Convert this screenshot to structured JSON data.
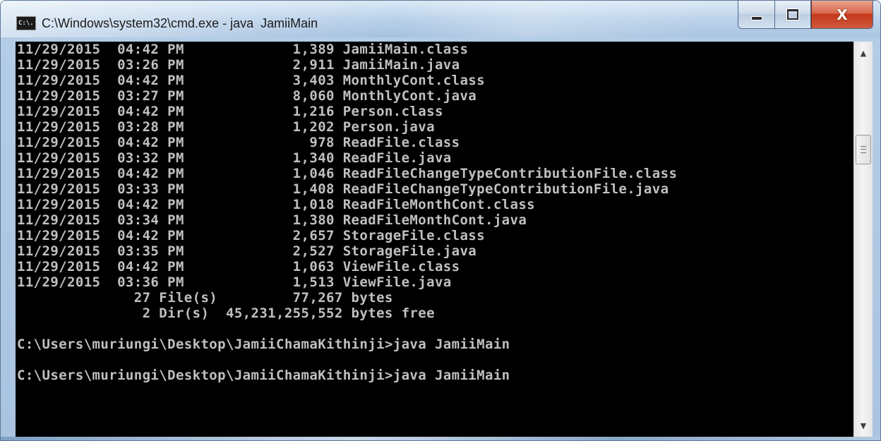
{
  "window": {
    "title": "C:\\Windows\\system32\\cmd.exe - java  JamiiMain",
    "icon_text": "C:\\."
  },
  "caption": {
    "minimize": "minimize",
    "maximize": "maximize",
    "close_label": "X"
  },
  "console": {
    "lines": [
      "11/29/2015  04:42 PM             1,389 JamiiMain.class",
      "11/29/2015  03:26 PM             2,911 JamiiMain.java",
      "11/29/2015  04:42 PM             3,403 MonthlyCont.class",
      "11/29/2015  03:27 PM             8,060 MonthlyCont.java",
      "11/29/2015  04:42 PM             1,216 Person.class",
      "11/29/2015  03:28 PM             1,202 Person.java",
      "11/29/2015  04:42 PM               978 ReadFile.class",
      "11/29/2015  03:32 PM             1,340 ReadFile.java",
      "11/29/2015  04:42 PM             1,046 ReadFileChangeTypeContributionFile.class",
      "11/29/2015  03:33 PM             1,408 ReadFileChangeTypeContributionFile.java",
      "11/29/2015  04:42 PM             1,018 ReadFileMonthCont.class",
      "11/29/2015  03:34 PM             1,380 ReadFileMonthCont.java",
      "11/29/2015  04:42 PM             2,657 StorageFile.class",
      "11/29/2015  03:35 PM             2,527 StorageFile.java",
      "11/29/2015  04:42 PM             1,063 ViewFile.class",
      "11/29/2015  03:36 PM             1,513 ViewFile.java",
      "              27 File(s)         77,267 bytes",
      "               2 Dir(s)  45,231,255,552 bytes free",
      "",
      "C:\\Users\\muriungi\\Desktop\\JamiiChamaKithinji>java JamiiMain",
      "",
      "C:\\Users\\muriungi\\Desktop\\JamiiChamaKithinji>java JamiiMain"
    ]
  },
  "scrollbar": {
    "up_icon": "arrow-up-icon",
    "down_icon": "arrow-down-icon"
  }
}
